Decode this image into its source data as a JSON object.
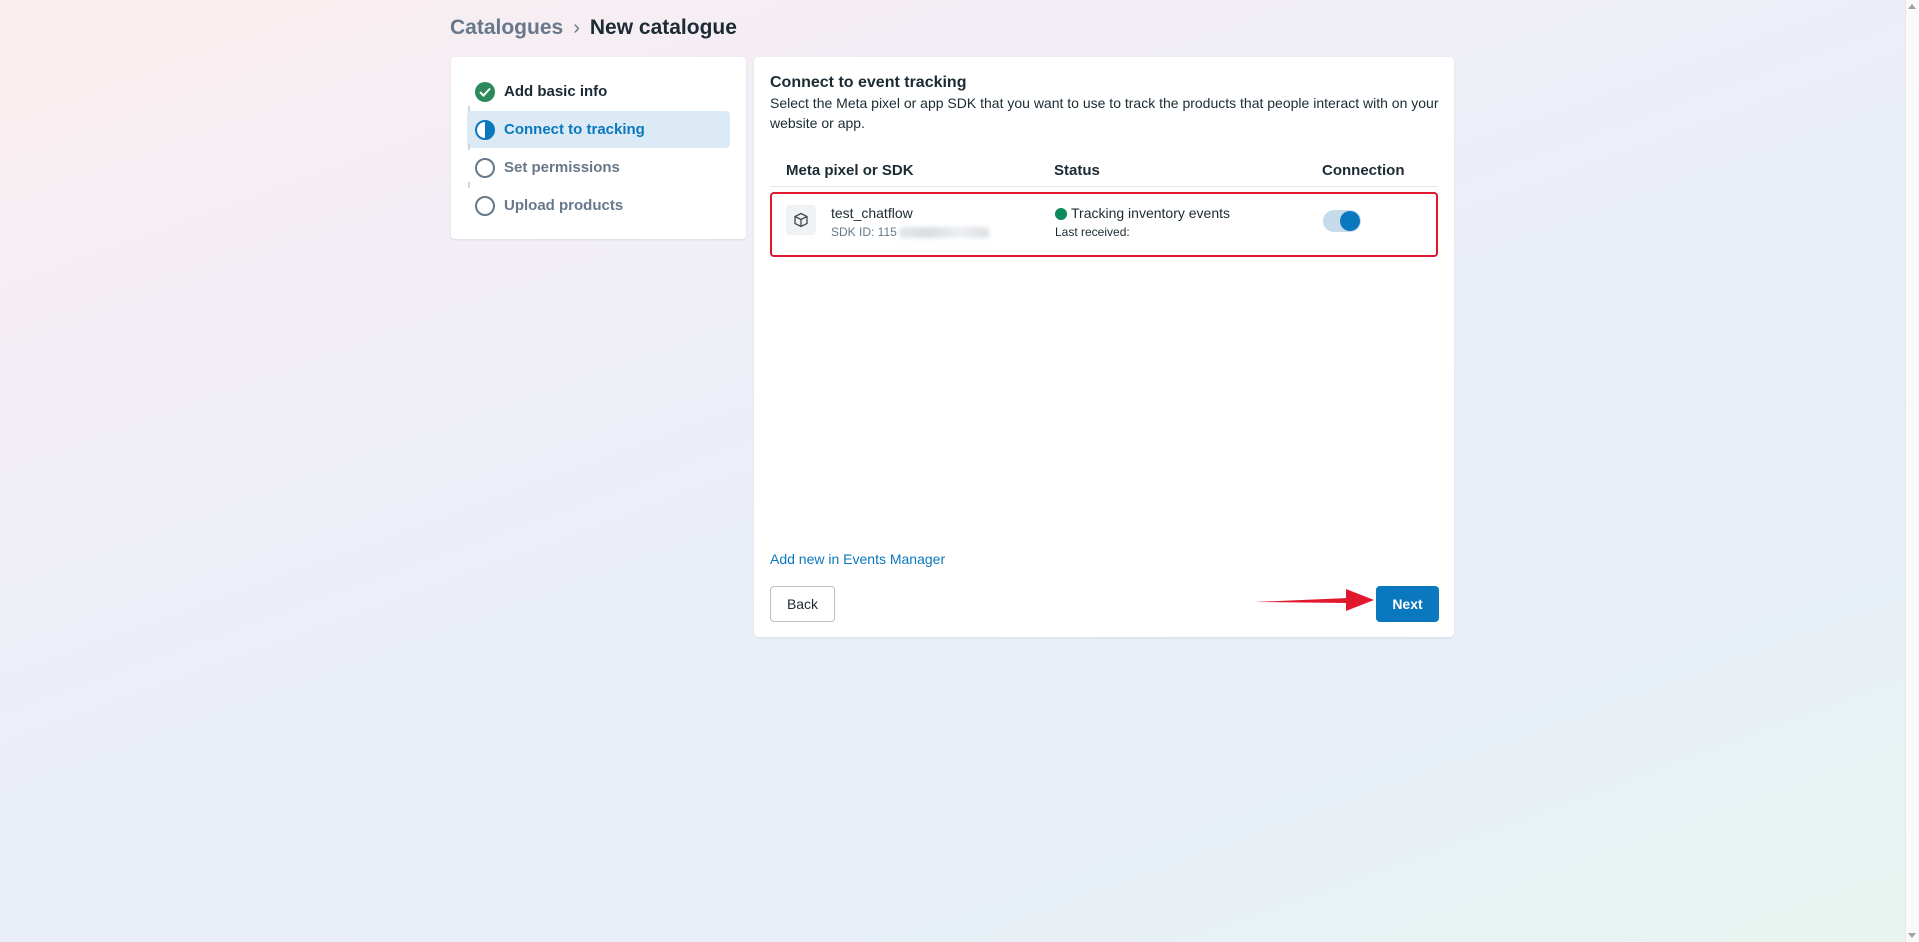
{
  "breadcrumb": {
    "root": "Catalogues",
    "separator": "›",
    "current": "New catalogue"
  },
  "steps": [
    {
      "label": "Add basic info",
      "state": "done",
      "icon": "check-circle-icon"
    },
    {
      "label": "Connect to tracking",
      "state": "active",
      "icon": "half-circle-icon"
    },
    {
      "label": "Set permissions",
      "state": "todo",
      "icon": "empty-circle-icon"
    },
    {
      "label": "Upload products",
      "state": "todo",
      "icon": "empty-circle-icon"
    }
  ],
  "main": {
    "title": "Connect to event tracking",
    "description": "Select the Meta pixel or app SDK that you want to use to track the products that people interact with on your website or app.",
    "table": {
      "headers": [
        "Meta pixel or SDK",
        "Status",
        "Connection"
      ],
      "rows": [
        {
          "name": "test_chatflow",
          "sdk_id": "SDK ID: 115",
          "status": "Tracking inventory events",
          "status_color": "#0d8a5b",
          "last_received": "Last received:",
          "connected": true,
          "icon": "box-icon"
        }
      ]
    },
    "add_link": "Add new in Events Manager",
    "back_label": "Back",
    "next_label": "Next"
  },
  "colors": {
    "accent": "#0a78be",
    "highlight_border": "#e0182d",
    "annotation_arrow": "#e0182d"
  }
}
